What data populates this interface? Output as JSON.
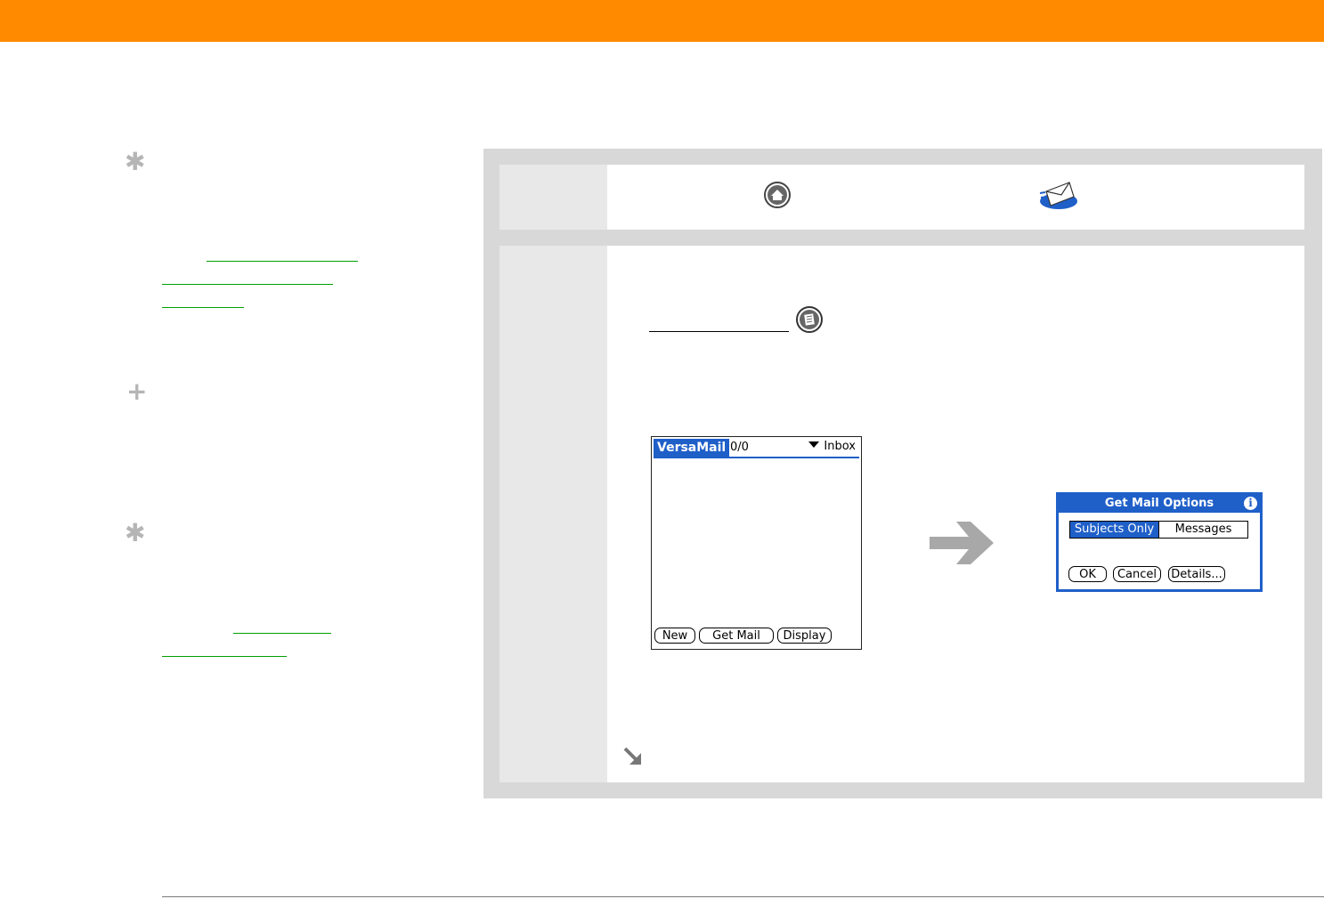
{
  "palm_left": {
    "app_title": "VersaMail",
    "message_count": "0/0",
    "folder": "Inbox",
    "buttons": {
      "new": "New",
      "get_mail": "Get Mail",
      "display": "Display"
    }
  },
  "palm_dialog": {
    "title": "Get Mail Options",
    "info": "i",
    "segments": {
      "subjects_only": "Subjects Only",
      "messages": "Messages"
    },
    "buttons": {
      "ok": "OK",
      "cancel": "Cancel",
      "details": "Details..."
    }
  },
  "colors": {
    "header": "#ff8a00",
    "palm_blue": "#1f5fc8",
    "link": "#00a000",
    "panel": "#d8d8d8"
  },
  "icons": {
    "sidebar": [
      "asterisk-tip-icon",
      "plus-tip-icon",
      "asterisk-tip-icon"
    ],
    "step1": [
      "home-icon",
      "versamail-envelope-icon"
    ],
    "step2": [
      "menu-icon",
      "right-arrow-icon",
      "continue-arrow-icon"
    ]
  }
}
